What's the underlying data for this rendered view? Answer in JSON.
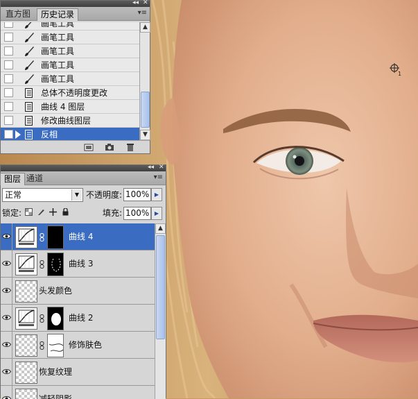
{
  "history_panel": {
    "tabs": [
      {
        "label": "直方图",
        "active": false
      },
      {
        "label": "历史记录",
        "active": true
      }
    ],
    "items": [
      {
        "label": "画笔工具",
        "icon": "brush-icon",
        "selected": false,
        "partial": true
      },
      {
        "label": "画笔工具",
        "icon": "brush-icon",
        "selected": false
      },
      {
        "label": "画笔工具",
        "icon": "brush-icon",
        "selected": false
      },
      {
        "label": "画笔工具",
        "icon": "brush-icon",
        "selected": false
      },
      {
        "label": "画笔工具",
        "icon": "brush-icon",
        "selected": false
      },
      {
        "label": "总体不透明度更改",
        "icon": "history-step-icon",
        "selected": false
      },
      {
        "label": "曲线 4 图层",
        "icon": "history-step-icon",
        "selected": false
      },
      {
        "label": "修改曲线图层",
        "icon": "history-step-icon",
        "selected": false
      },
      {
        "label": "反相",
        "icon": "history-step-icon",
        "selected": true
      }
    ],
    "footer_icons": [
      "new-document-from-state-icon",
      "new-snapshot-icon",
      "delete-state-icon"
    ]
  },
  "layers_panel": {
    "tabs": [
      {
        "label": "图层",
        "active": true
      },
      {
        "label": "通道",
        "active": false
      }
    ],
    "blend_mode": "正常",
    "opacity_label": "不透明度:",
    "opacity_value": "100%",
    "lock_label": "锁定:",
    "fill_label": "填充:",
    "fill_value": "100%",
    "layers": [
      {
        "name": "曲线 4",
        "type": "curves",
        "mask": "black",
        "visible": true,
        "selected": true
      },
      {
        "name": "曲线 3",
        "type": "curves",
        "mask": "black-outline",
        "visible": true,
        "selected": false
      },
      {
        "name": "头发颜色",
        "type": "pixel",
        "mask": null,
        "visible": true,
        "selected": false
      },
      {
        "name": "曲线 2",
        "type": "curves",
        "mask": "black-white-blob",
        "visible": true,
        "selected": false
      },
      {
        "name": "修饰肤色",
        "type": "pixel",
        "mask": "white-with-lines",
        "visible": true,
        "selected": false
      },
      {
        "name": "恢复纹理",
        "type": "pixel",
        "mask": null,
        "visible": true,
        "selected": false
      },
      {
        "name": "减轻阴影",
        "type": "pixel",
        "mask": null,
        "visible": true,
        "selected": false,
        "partial": true
      }
    ]
  },
  "canvas": {
    "cursor_icon": "color-sampler-icon",
    "cursor_index": "1",
    "colors": {
      "skin": "#e3b08f",
      "hair": "#c79a5e",
      "lips": "#c77f6d",
      "iris": "#6d7f72"
    }
  }
}
